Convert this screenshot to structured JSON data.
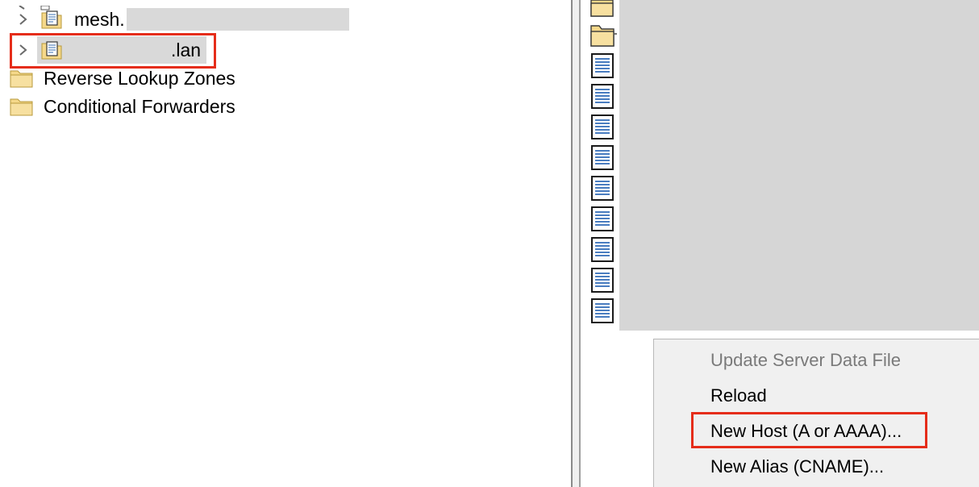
{
  "tree": {
    "items": [
      {
        "label": "mesh.",
        "type": "zone",
        "expanded": false
      },
      {
        "label": ".lan",
        "type": "zone",
        "expanded": false,
        "selected": true
      },
      {
        "label": "Reverse Lookup Zones",
        "type": "folder"
      },
      {
        "label": "Conditional Forwarders",
        "type": "folder"
      }
    ]
  },
  "context_menu": {
    "items": [
      {
        "label": "Update Server Data File",
        "enabled": false
      },
      {
        "label": "Reload",
        "enabled": true
      },
      {
        "label": "New Host (A or AAAA)...",
        "enabled": true,
        "highlighted": true
      },
      {
        "label": "New Alias (CNAME)...",
        "enabled": true
      }
    ]
  },
  "colors": {
    "highlight_border": "#e52d1a",
    "folder_fill": "#f5d88a",
    "redaction_gray": "#d6d6d6"
  }
}
